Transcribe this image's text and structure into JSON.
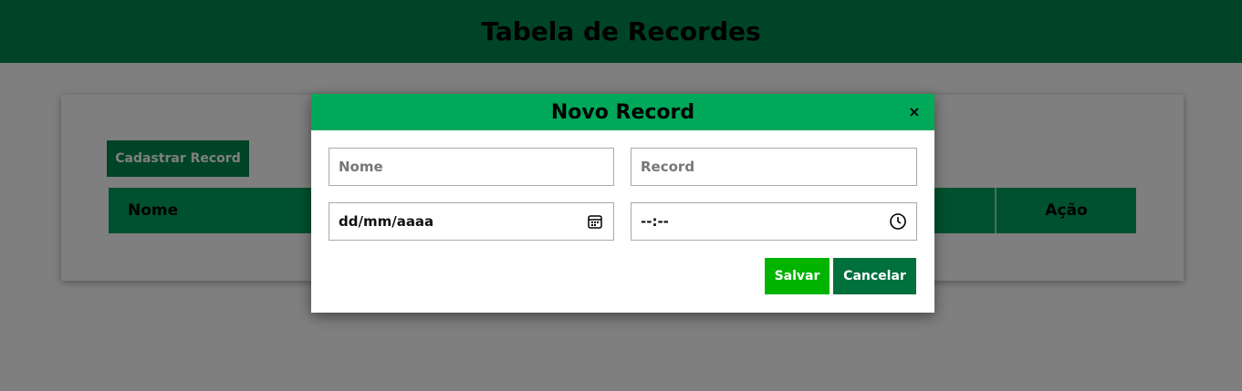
{
  "header": {
    "title": "Tabela de Recordes"
  },
  "card": {
    "register_button": "Cadastrar Record",
    "table_headers": [
      "Nome",
      "Ação"
    ]
  },
  "modal": {
    "title": "Novo Record",
    "close_label": "×",
    "fields": {
      "nome_placeholder": "Nome",
      "record_placeholder": "Record",
      "date_value": "dd/mm/aaaa",
      "time_value": "--:--"
    },
    "buttons": {
      "save": "Salvar",
      "cancel": "Cancelar"
    }
  },
  "icons": {
    "date": "calendar-icon",
    "time": "clock-icon"
  },
  "colors": {
    "header_bg": "#008850",
    "modal_header_bg": "#00a85a",
    "save_bg": "#00b400",
    "cancel_bg": "#00703c"
  }
}
